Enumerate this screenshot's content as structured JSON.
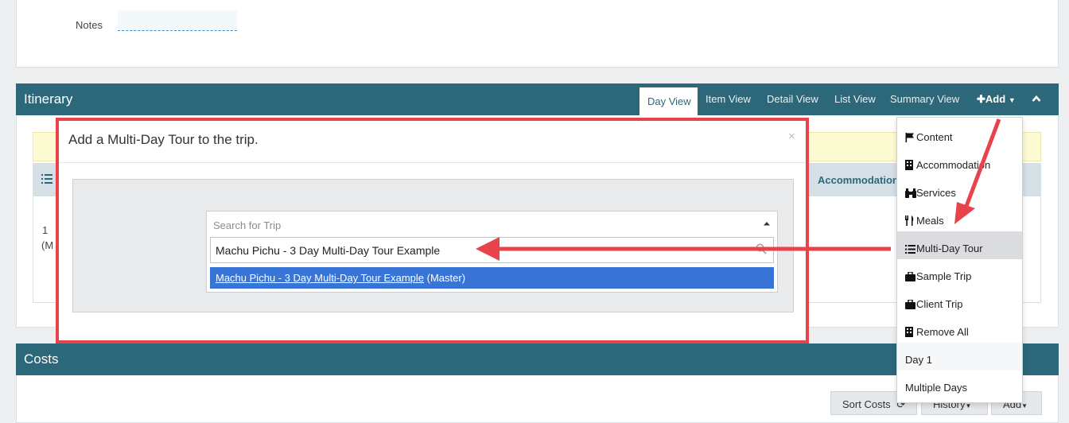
{
  "notes": {
    "label": "Notes",
    "value": ""
  },
  "itinerary": {
    "title": "Itinerary",
    "tabs": [
      "Day View",
      "Item View",
      "Detail View",
      "List View",
      "Summary View"
    ],
    "active_tab": "Day View",
    "add_label": "Add",
    "table_header_accommodation": "Accommodation",
    "row_number": "1",
    "row_sub_partial": "(M"
  },
  "modal": {
    "title": "Add a Multi-Day Tour to the trip.",
    "close": "×",
    "select_placeholder": "Search for Trip",
    "search_value": "Machu Pichu - 3 Day Multi-Day Tour Example",
    "result_link": "Machu Pichu - 3 Day Multi-Day Tour Example",
    "result_suffix": " (Master)"
  },
  "add_menu": {
    "items": [
      {
        "label": "Content",
        "icon": "flag-icon"
      },
      {
        "label": "Accommodation",
        "icon": "building-icon"
      },
      {
        "label": "Services",
        "icon": "binoculars-icon"
      },
      {
        "label": "Meals",
        "icon": "utensils-icon"
      },
      {
        "label": "Multi-Day Tour",
        "icon": "list-icon",
        "highlighted": true
      },
      {
        "label": "Sample Trip",
        "icon": "suitcase-icon"
      },
      {
        "label": "Client Trip",
        "icon": "suitcase-icon"
      },
      {
        "label": "Remove All",
        "icon": "building-icon"
      },
      {
        "label": "Day 1"
      },
      {
        "label": "Multiple Days"
      }
    ]
  },
  "costs": {
    "title": "Costs",
    "buttons": {
      "sort": "Sort Costs",
      "history": "History",
      "add": "Add"
    }
  },
  "colors": {
    "header": "#2c6879",
    "annotation_red": "#e8424a",
    "highlight_blue": "#3875d7"
  }
}
